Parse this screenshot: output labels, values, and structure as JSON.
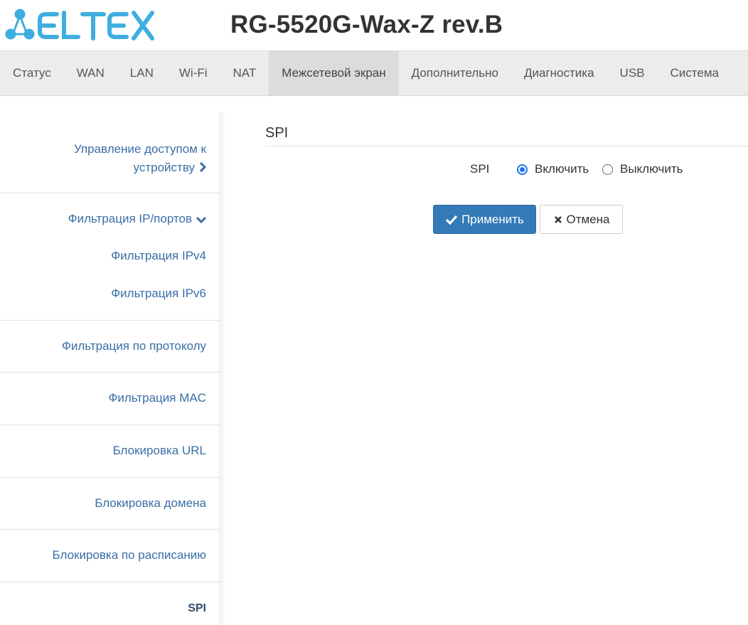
{
  "header": {
    "brand": "ELTEX",
    "device_title": "RG-5520G-Wax-Z rev.B"
  },
  "topnav": {
    "tabs": [
      {
        "label": "Статус"
      },
      {
        "label": "WAN"
      },
      {
        "label": "LAN"
      },
      {
        "label": "Wi-Fi"
      },
      {
        "label": "NAT"
      },
      {
        "label": "Межсетевой экран",
        "active": true
      },
      {
        "label": "Дополнительно"
      },
      {
        "label": "Диагностика"
      },
      {
        "label": "USB"
      },
      {
        "label": "Система"
      }
    ]
  },
  "sidebar": {
    "items": [
      {
        "label_line1": "Управление доступом к",
        "label_line2": "устройству",
        "icon": "chevron-right-icon"
      },
      {
        "label": "Фильтрация IP/портов",
        "icon": "chevron-down-icon",
        "expanded": true
      },
      {
        "label": "Фильтрация IPv4"
      },
      {
        "label": "Фильтрация IPv6"
      },
      {
        "label": "Фильтрация по протоколу"
      },
      {
        "label": "Фильтрация MAC"
      },
      {
        "label": "Блокировка URL"
      },
      {
        "label": "Блокировка домена"
      },
      {
        "label": "Блокировка по расписанию"
      },
      {
        "label": "SPI",
        "active": true
      }
    ]
  },
  "main": {
    "section_title": "SPI",
    "field_label": "SPI",
    "options": [
      {
        "label": "Включить",
        "selected": true
      },
      {
        "label": "Выключить",
        "selected": false
      }
    ],
    "apply_label": "Применить",
    "cancel_label": "Отмена"
  },
  "colors": {
    "brand": "#3eaee0",
    "link": "#3a6ea5",
    "primary_button": "#337ab7",
    "radio_accent": "#1a73e8"
  }
}
